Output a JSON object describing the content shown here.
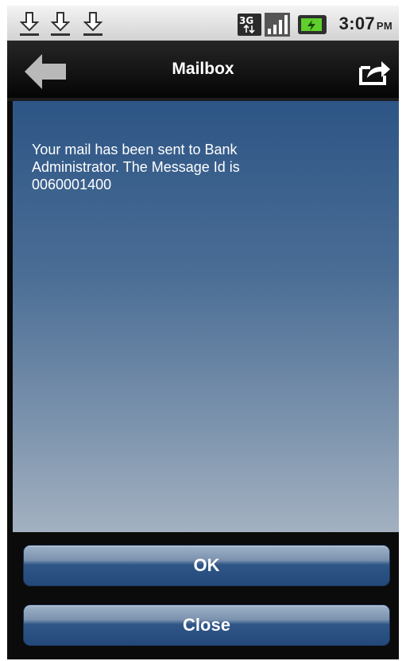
{
  "status_bar": {
    "time": "3:07",
    "ampm": "PM",
    "network_badge": "3G",
    "icons": [
      "download-icon",
      "download-icon",
      "download-icon",
      "3g-icon",
      "signal-icon",
      "battery-charging-icon"
    ]
  },
  "header": {
    "title": "Mailbox",
    "back_icon": "back-arrow-icon",
    "share_icon": "share-icon"
  },
  "content": {
    "message": "Your mail has been sent to Bank Administrator. The Message Id is 0060001400"
  },
  "buttons": {
    "ok_label": "OK",
    "close_label": "Close"
  },
  "colors": {
    "content_top": "#2d5585",
    "content_bottom": "#a3b1c1",
    "button_dark": "#22497a",
    "title_bar": "#050505"
  }
}
